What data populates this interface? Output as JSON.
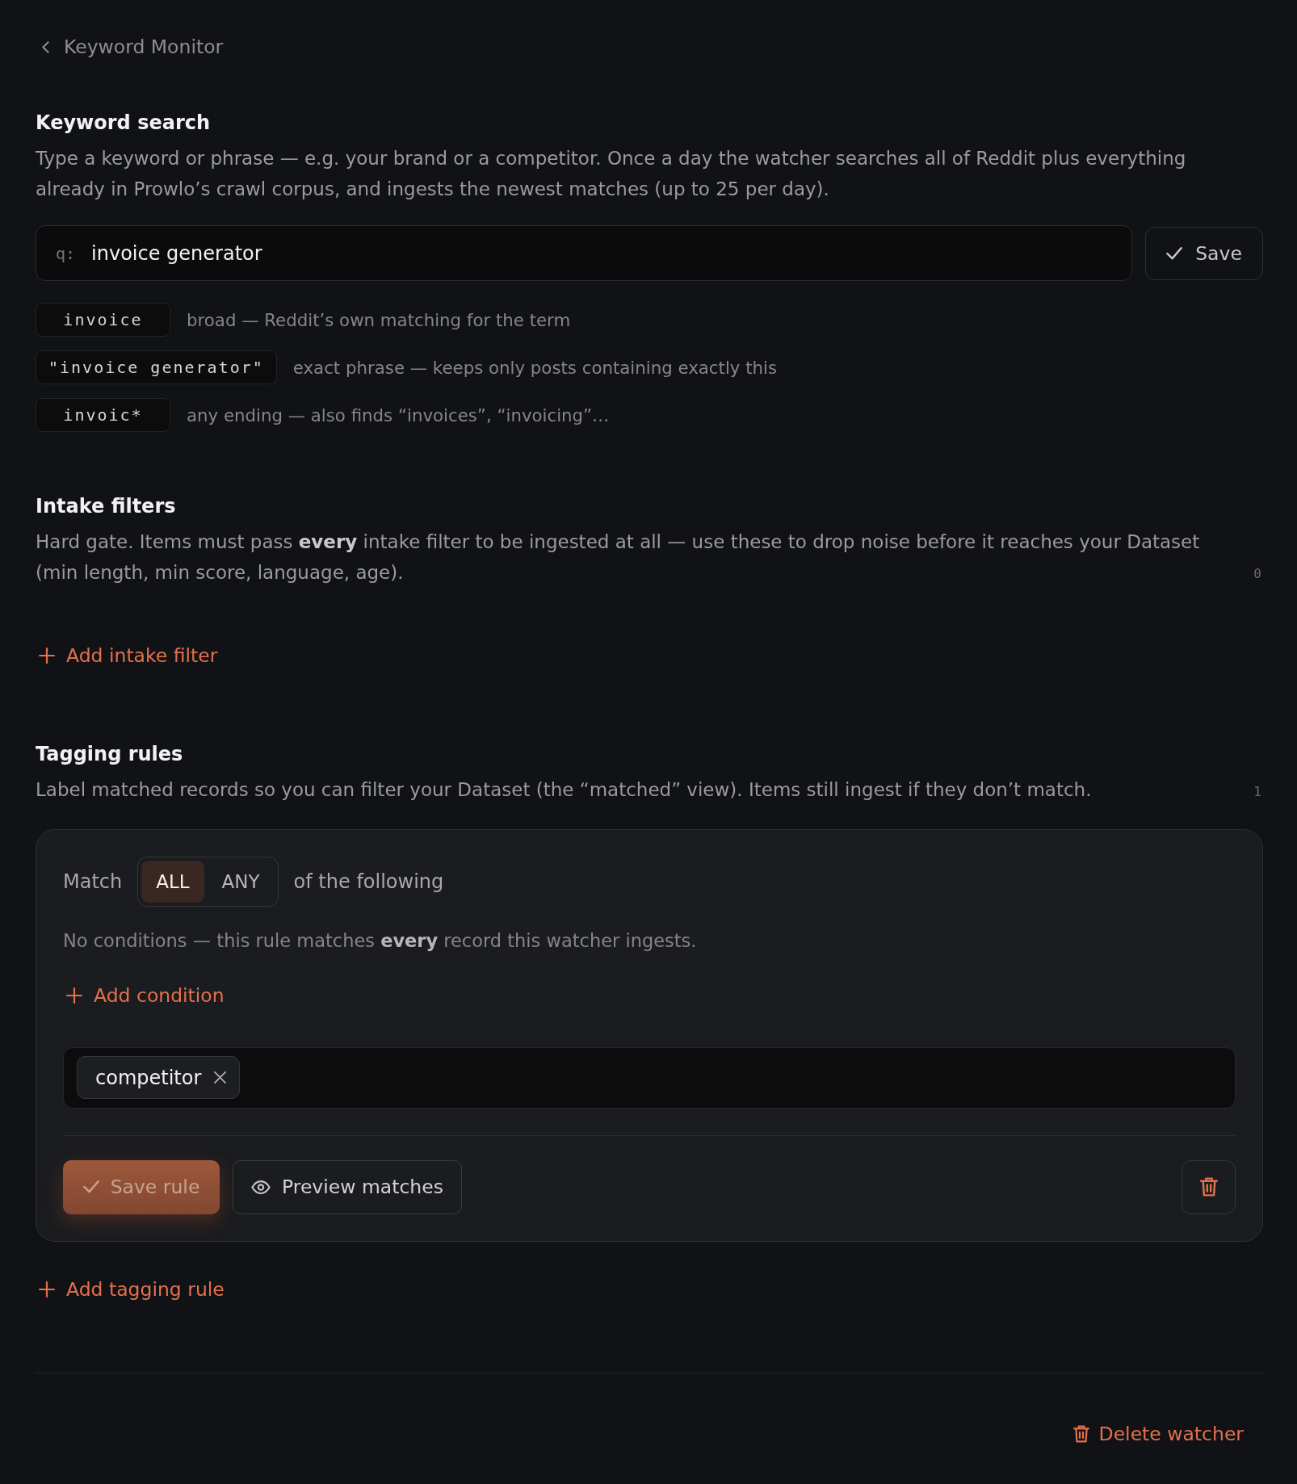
{
  "back": {
    "label": "Keyword Monitor"
  },
  "keyword_search": {
    "title": "Keyword search",
    "description": "Type a keyword or phrase — e.g. your brand or a competitor. Once a day the watcher searches all of Reddit plus everything already in Prowlo’s crawl corpus, and ingests the newest matches (up to 25 per day).",
    "query": {
      "prefix": "q:",
      "value": "invoice generator"
    },
    "save_button": {
      "label": "Save"
    },
    "syntax_examples": [
      {
        "code": "invoice",
        "description": "broad — Reddit’s own matching for the term"
      },
      {
        "code": "\"invoice generator\"",
        "description": "exact phrase — keeps only posts containing exactly this"
      },
      {
        "code": "invoic*",
        "description": "any ending — also finds “invoices”, “invoicing”…"
      }
    ]
  },
  "intake_filters": {
    "title": "Intake filters",
    "description": "Hard gate. Items must pass **every** intake filter to be ingested at all — use these to drop noise before it reaches your Dataset (min length, min score, language, age).",
    "count": "0",
    "add_button": {
      "label": "Add intake filter"
    }
  },
  "tagging_rules": {
    "title": "Tagging rules",
    "description": "Label matched records so you can filter your Dataset (the “matched” view). Items still ingest if they don’t match.",
    "count": "1",
    "rules": [
      {
        "match_label": "Match",
        "modes": [
          {
            "label": "ALL",
            "selected": true
          },
          {
            "label": "ANY",
            "selected": false
          }
        ],
        "match_suffix": "of the following",
        "empty_note": "No conditions — this rule matches **every** record this watcher ingests.",
        "add_condition": {
          "label": "Add condition"
        },
        "tags": [
          {
            "label": "competitor"
          }
        ],
        "save_button": {
          "label": "Save rule",
          "disabled": true
        },
        "preview_button": {
          "label": "Preview matches"
        }
      }
    ],
    "add_button": {
      "label": "Add tagging rule"
    }
  },
  "footer": {
    "delete_button": {
      "label": "Delete watcher"
    }
  }
}
